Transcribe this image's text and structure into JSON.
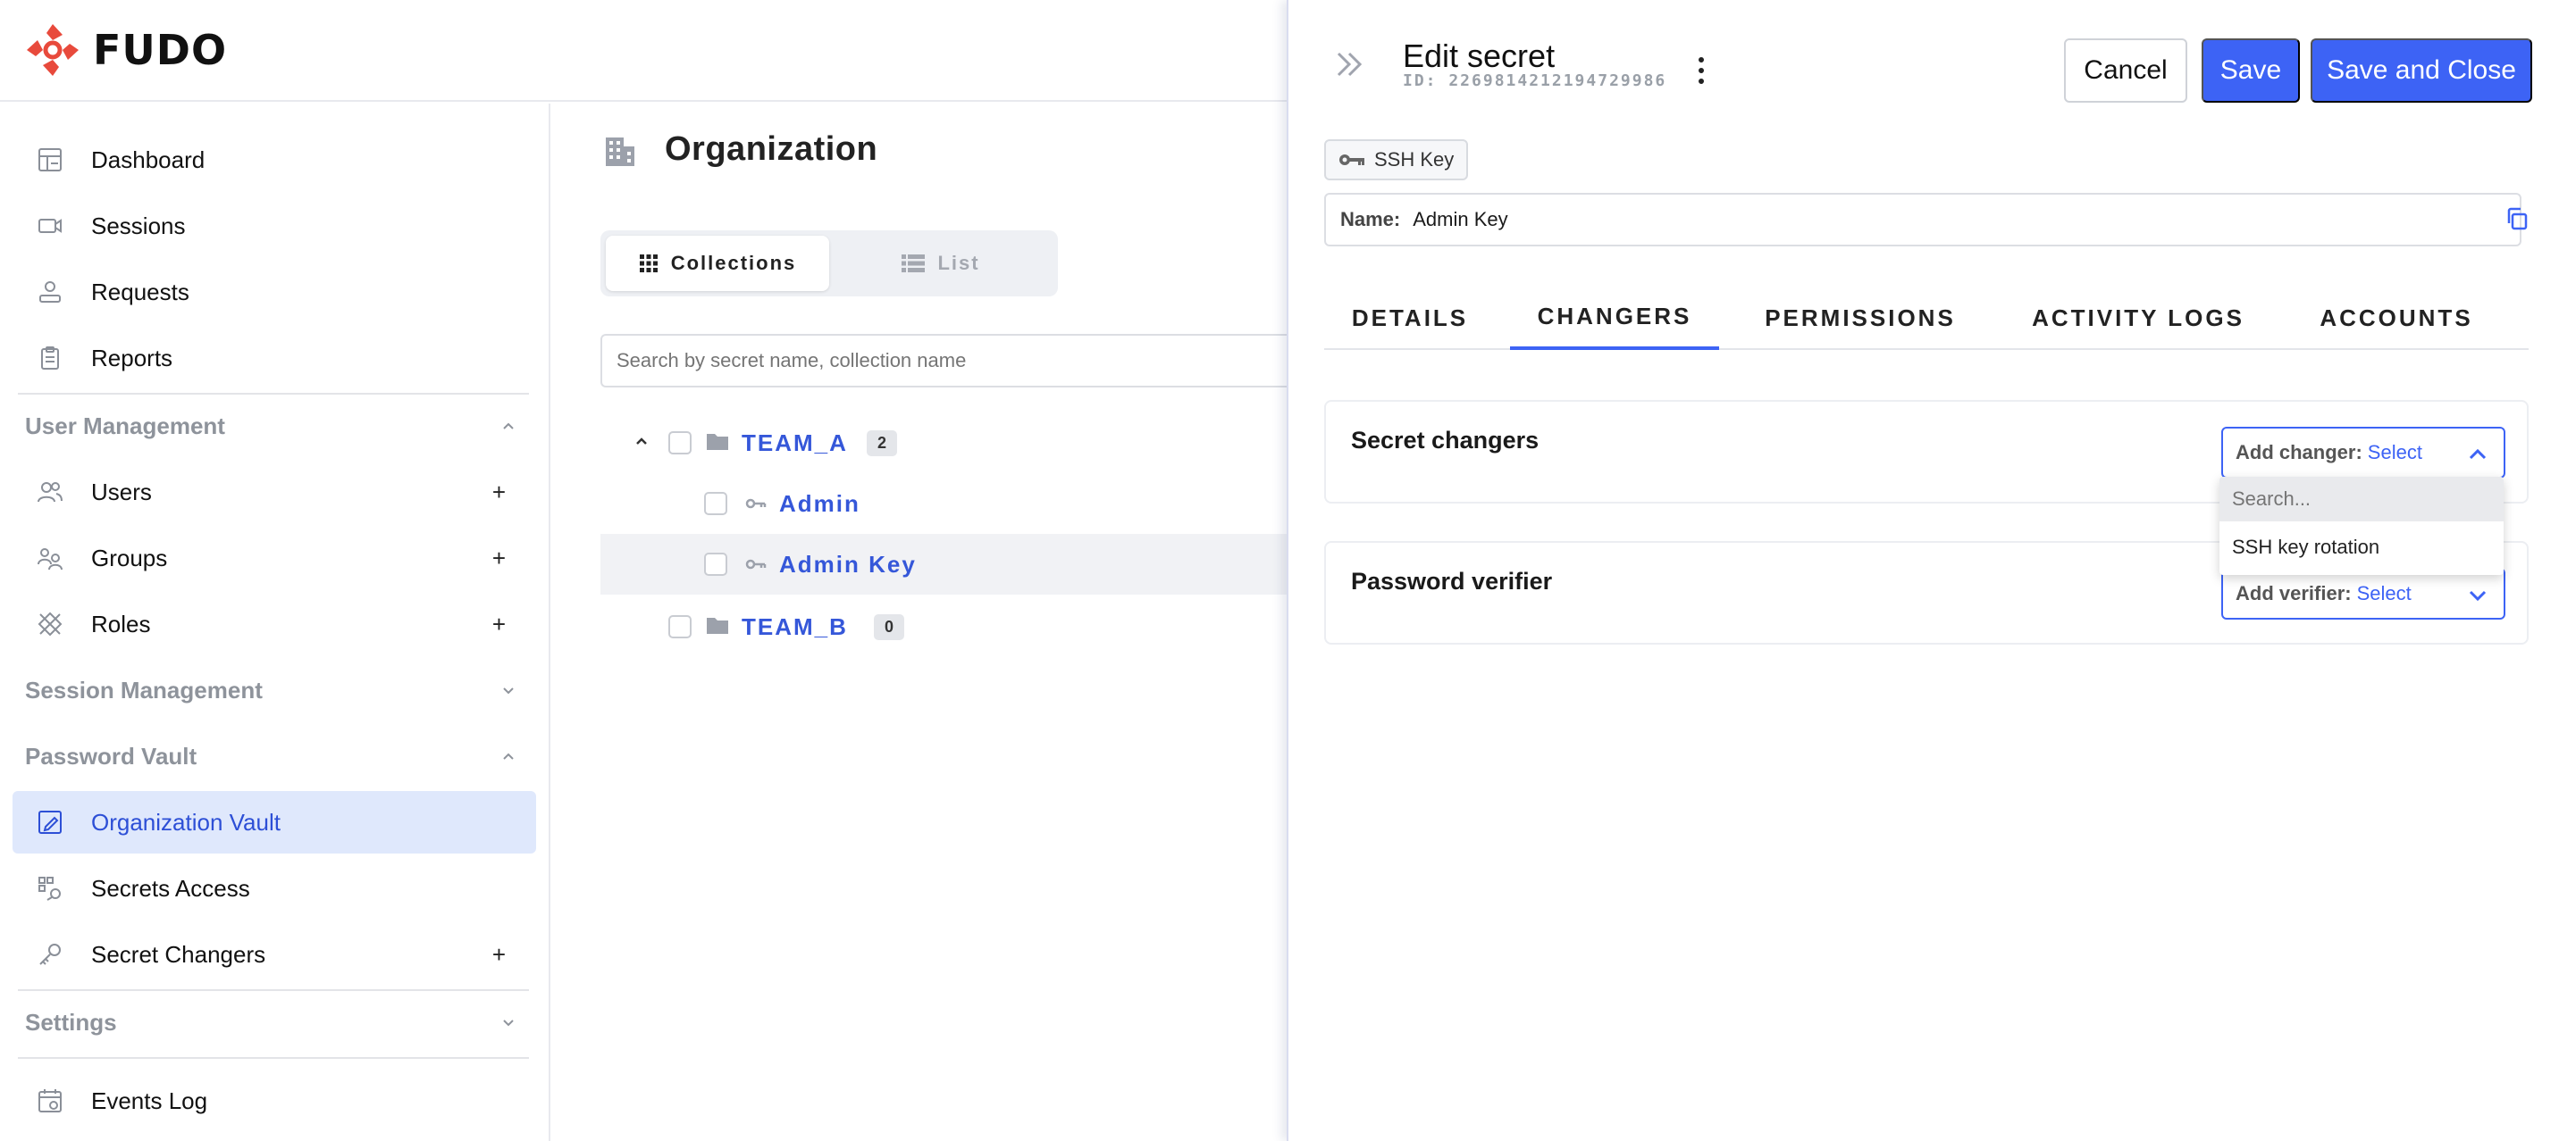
{
  "brand": {
    "name": "FUDO",
    "accent": "#e84a3c"
  },
  "sidebar": {
    "items": [
      {
        "label": "Dashboard",
        "icon": "dashboard-icon"
      },
      {
        "label": "Sessions",
        "icon": "video-icon"
      },
      {
        "label": "Requests",
        "icon": "requests-icon"
      },
      {
        "label": "Reports",
        "icon": "clipboard-icon"
      }
    ],
    "sections": {
      "user_management": "User Management",
      "session_management": "Session Management",
      "password_vault": "Password Vault",
      "settings": "Settings"
    },
    "user_items": [
      {
        "label": "Users",
        "plus": "+"
      },
      {
        "label": "Groups",
        "plus": "+"
      },
      {
        "label": "Roles",
        "plus": "+"
      }
    ],
    "vault_items": [
      {
        "label": "Organization Vault"
      },
      {
        "label": "Secrets Access"
      },
      {
        "label": "Secret Changers",
        "plus": "+"
      }
    ],
    "settings_items": [
      {
        "label": "Events Log"
      }
    ]
  },
  "main": {
    "title": "Organization",
    "views": [
      "Collections",
      "List"
    ],
    "search_placeholder": "Search by secret name, collection name",
    "tree": [
      {
        "label": "TEAM_A",
        "count": "2"
      },
      {
        "label": "Admin"
      },
      {
        "label": "Admin Key"
      },
      {
        "label": "TEAM_B",
        "count": "0"
      }
    ]
  },
  "drawer": {
    "title": "Edit secret",
    "id_text": "ID: 2269814212194729986",
    "buttons": {
      "cancel": "Cancel",
      "save": "Save",
      "save_close": "Save and Close"
    },
    "type_chip": "SSH Key",
    "name_label": "Name:",
    "name_value": "Admin Key",
    "tabs": [
      "DETAILS",
      "CHANGERS",
      "PERMISSIONS",
      "ACTIVITY LOGS",
      "ACCOUNTS"
    ],
    "changers": {
      "title": "Secret changers",
      "select_label": "Add changer:",
      "select_value": "Select",
      "search_placeholder": "Search...",
      "options": [
        "SSH key rotation"
      ]
    },
    "verifier": {
      "title": "Password verifier",
      "select_label": "Add verifier:",
      "select_value": "Select"
    }
  },
  "colors": {
    "primary": "#3d63f5",
    "active_bg": "#dfe8fc",
    "link": "#3557d9"
  }
}
